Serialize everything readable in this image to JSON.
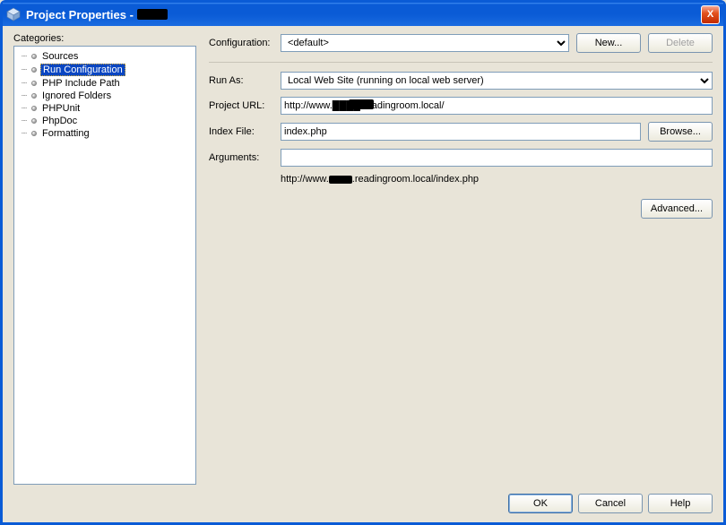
{
  "window": {
    "title_prefix": "Project Properties -",
    "close_glyph": "X"
  },
  "categories": {
    "label": "Categories:",
    "items": [
      {
        "label": "Sources",
        "selected": false
      },
      {
        "label": "Run Configuration",
        "selected": true
      },
      {
        "label": "PHP Include Path",
        "selected": false
      },
      {
        "label": "Ignored Folders",
        "selected": false
      },
      {
        "label": "PHPUnit",
        "selected": false
      },
      {
        "label": "PhpDoc",
        "selected": false
      },
      {
        "label": "Formatting",
        "selected": false
      }
    ]
  },
  "config": {
    "label": "Configuration:",
    "value": "<default>",
    "new_btn": "New...",
    "delete_btn": "Delete"
  },
  "form": {
    "run_as_label": "Run As:",
    "run_as_value": "Local Web Site (running on local web server)",
    "project_url_label": "Project URL:",
    "project_url_value": "http://www.████.readingroom.local/",
    "index_label": "Index File:",
    "index_value": "index.php",
    "browse_btn": "Browse...",
    "args_label": "Arguments:",
    "args_value": "",
    "url_preview_prefix": "http://www.",
    "url_preview_suffix": ".readingroom.local/index.php",
    "advanced_btn": "Advanced..."
  },
  "footer": {
    "ok": "OK",
    "cancel": "Cancel",
    "help": "Help"
  }
}
